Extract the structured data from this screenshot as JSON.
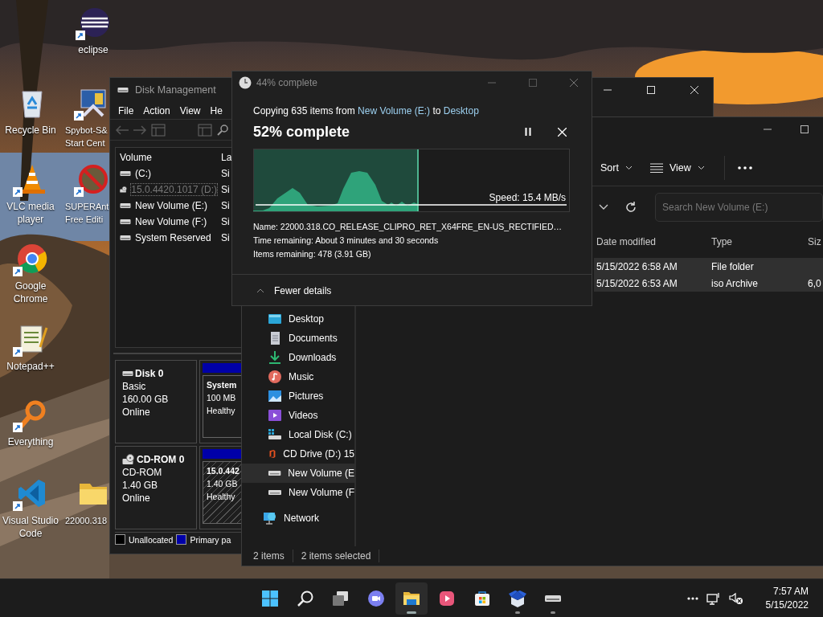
{
  "desktop_icons": [
    {
      "kind": "eclipse",
      "label": "eclipse",
      "shortcut": true
    },
    {
      "kind": "recycle-bin",
      "label": "Recycle Bin",
      "shortcut": false
    },
    {
      "kind": "spybot",
      "label": "Spybot-S&\nStart Cent",
      "shortcut": true
    },
    {
      "kind": "vlc",
      "label": "VLC media\nplayer",
      "shortcut": true
    },
    {
      "kind": "superantispyware",
      "label": "SUPERAnt\nFree Editi",
      "shortcut": true
    },
    {
      "kind": "chrome",
      "label": "Google\nChrome",
      "shortcut": true
    },
    {
      "kind": "notepad",
      "label": "Notepad++",
      "shortcut": true
    },
    {
      "kind": "everything",
      "label": "Everything",
      "shortcut": true
    },
    {
      "kind": "vscode",
      "label": "Visual Studio\nCode",
      "shortcut": true
    },
    {
      "kind": "folder",
      "label": "22000.318",
      "shortcut": false
    }
  ],
  "disk_management": {
    "title": "Disk Management",
    "menu": [
      "File",
      "Action",
      "View",
      "He"
    ],
    "volume_columns": [
      "Volume",
      "La"
    ],
    "volumes": [
      {
        "kind": "disk",
        "name": "(C:)",
        "column_2": "Si",
        "focused": false
      },
      {
        "kind": "cd",
        "name": "15.0.4420.1017 (D:)",
        "column_2": "Si",
        "focused": true
      },
      {
        "kind": "disk",
        "name": "New Volume (E:)",
        "column_2": "Si",
        "focused": false
      },
      {
        "kind": "disk",
        "name": "New Volume (F:)",
        "column_2": "Si",
        "focused": false
      },
      {
        "kind": "disk",
        "name": "System Reserved",
        "column_2": "Si",
        "focused": false
      }
    ],
    "disks": [
      {
        "kind": "disk",
        "name": "Disk 0",
        "type": "Basic",
        "size": "160.00 GB",
        "status": "Online",
        "partition": {
          "kind": "primary",
          "name": "System",
          "size": "100 MB",
          "status": "Healthy"
        }
      },
      {
        "kind": "cd",
        "name": "CD-ROM 0",
        "type": "CD-ROM",
        "size": "1.40 GB",
        "status": "Online",
        "partition": {
          "kind": "cd",
          "name": "15.0.442",
          "size": "1.40 GB",
          "status": "Healthy"
        }
      }
    ],
    "legend": [
      {
        "label": "Unallocated",
        "color": "#000000"
      },
      {
        "label": "Primary pa",
        "color": "#0000a8"
      }
    ]
  },
  "file_explorer": {
    "toolbar": [
      {
        "kind": "sort",
        "label": "Sort"
      },
      {
        "kind": "view",
        "label": "View"
      }
    ],
    "search": {
      "placeholder": "Search New Volume (E:)"
    },
    "columns": [
      "Date modified",
      "Type",
      "Siz"
    ],
    "rows": [
      {
        "date": "5/15/2022 6:58 AM",
        "type": "File folder",
        "selected": true
      },
      {
        "date": "5/15/2022 6:53 AM",
        "type": "iso Archive",
        "size": "6,0",
        "selected": true
      }
    ],
    "nav": [
      {
        "kind": "desktop",
        "label": "Desktop",
        "selected": false
      },
      {
        "kind": "documents",
        "label": "Documents",
        "selected": false
      },
      {
        "kind": "downloads",
        "label": "Downloads",
        "selected": false
      },
      {
        "kind": "music",
        "label": "Music",
        "selected": false
      },
      {
        "kind": "pictures",
        "label": "Pictures",
        "selected": false
      },
      {
        "kind": "videos",
        "label": "Videos",
        "selected": false
      },
      {
        "kind": "system-drive",
        "label": "Local Disk (C:)",
        "selected": false
      },
      {
        "kind": "office-drive",
        "label": "CD Drive (D:) 15",
        "selected": false
      },
      {
        "kind": "drive",
        "label": "New Volume (E",
        "selected": true
      },
      {
        "kind": "drive",
        "label": "New Volume (F",
        "selected": false
      },
      {
        "kind": "network",
        "label": "Network",
        "selected": false
      }
    ],
    "status": [
      "2 items",
      "2 items selected"
    ]
  },
  "copy_dialog": {
    "title": "44% complete",
    "summary": [
      {
        "kind": "text",
        "text": "Copying 635 items from "
      },
      {
        "kind": "link",
        "text": "New Volume (E:)"
      },
      {
        "kind": "text",
        "text": " to "
      },
      {
        "kind": "link",
        "text": "Desktop"
      }
    ],
    "heading": "52% complete",
    "progress": {
      "level": 0.52
    },
    "speed": "Speed: 15.4 MB/s",
    "details": [
      "Name:  22000.318.CO_RELEASE_CLIPRO_RET_X64FRE_EN-US_RECTIFIED…",
      "Time remaining:  About 3 minutes and 30 seconds",
      "Items remaining:  478 (3.91 GB)"
    ],
    "toggle": {
      "label": "Fewer details",
      "expanded": true
    }
  },
  "taskbar": {
    "apps": [
      {
        "kind": "start",
        "selected": false,
        "running": false
      },
      {
        "kind": "search",
        "selected": false,
        "running": false
      },
      {
        "kind": "task-view",
        "selected": false,
        "running": false
      },
      {
        "kind": "chat",
        "selected": false,
        "running": false
      },
      {
        "kind": "explorer",
        "selected": true,
        "running": true
      },
      {
        "kind": "media",
        "selected": false,
        "running": false
      },
      {
        "kind": "store",
        "selected": false,
        "running": false
      },
      {
        "kind": "box",
        "selected": false,
        "running": true
      },
      {
        "kind": "drive",
        "selected": false,
        "running": true
      }
    ],
    "time": "7:57 AM",
    "date": "5/15/2022"
  }
}
